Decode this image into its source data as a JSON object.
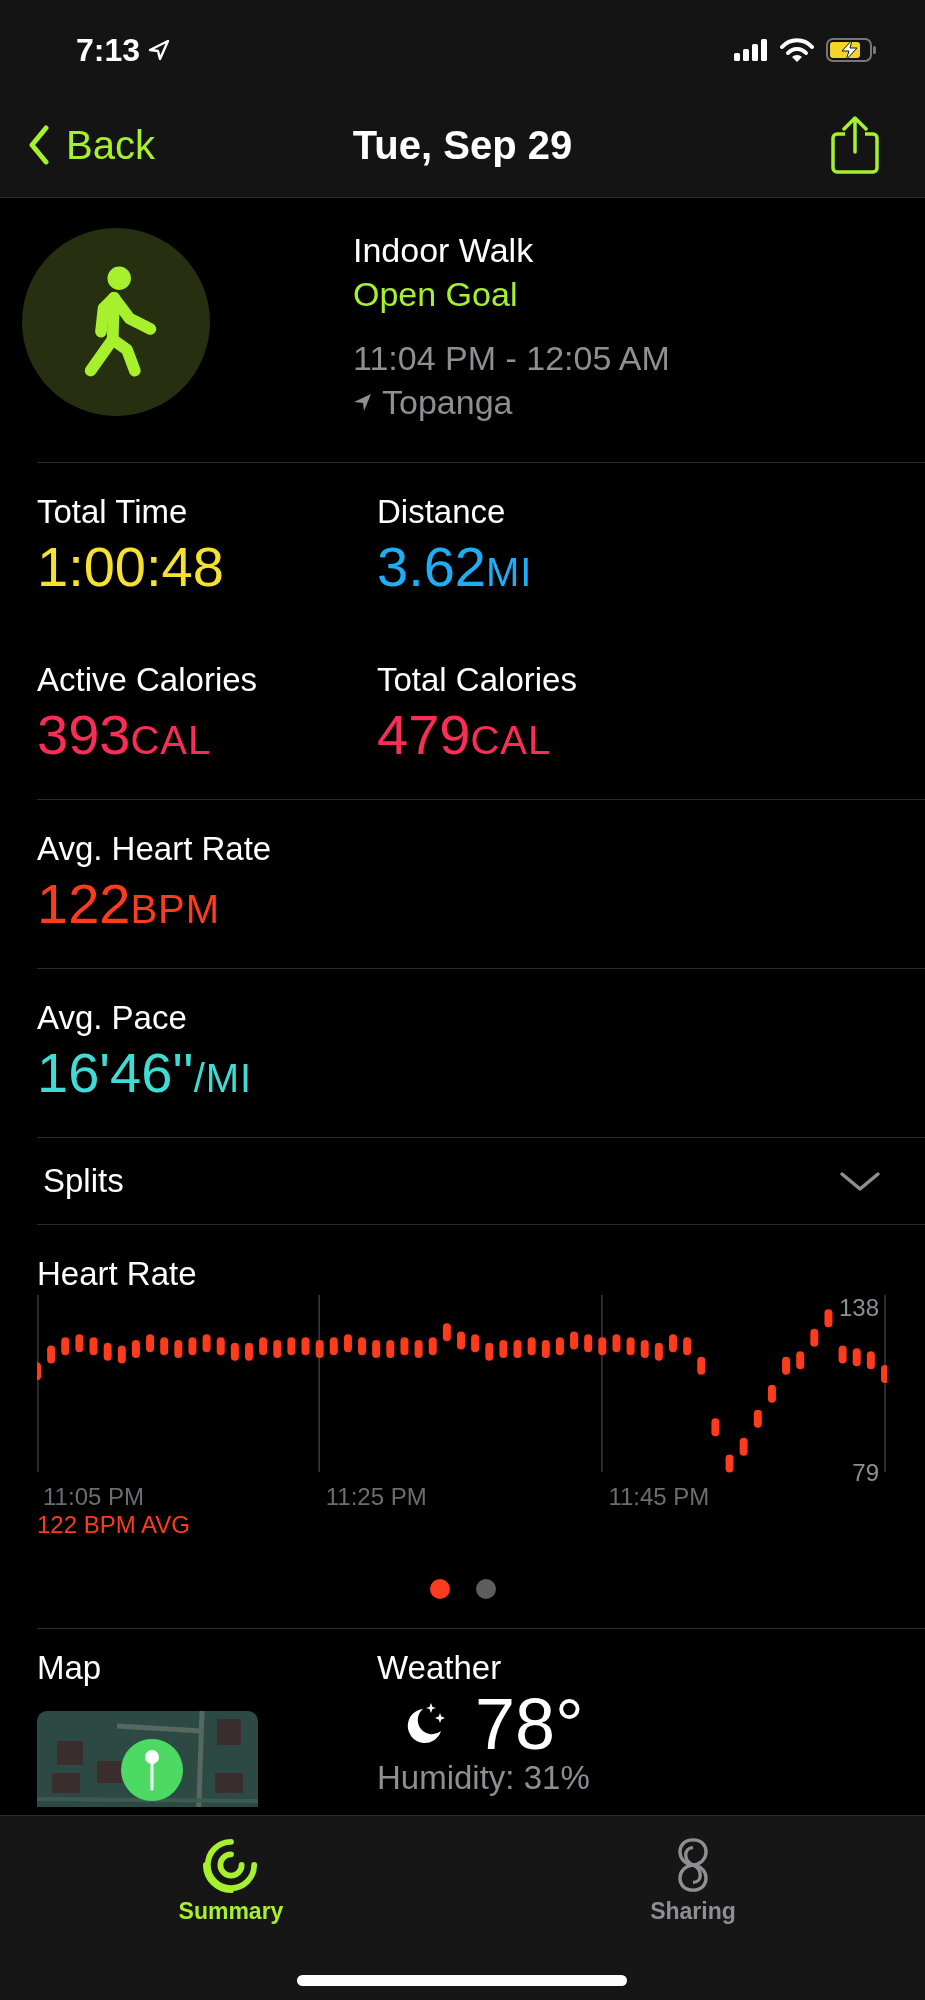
{
  "status_bar": {
    "time": "7:13"
  },
  "nav": {
    "back": "Back",
    "title": "Tue, Sep 29"
  },
  "workout": {
    "name": "Indoor Walk",
    "goal": "Open Goal",
    "time_range": "11:04 PM - 12:05 AM",
    "location": "Topanga"
  },
  "metric_rows": [
    [
      {
        "label": "Total Time",
        "value": "1:00:48",
        "color": "#f5e12e"
      },
      {
        "label": "Distance",
        "value": "3.62",
        "unit": "MI",
        "color": "#1eaef5"
      }
    ],
    [
      {
        "label": "Active Calories",
        "value": "393",
        "unit": "CAL",
        "color": "#fa2d55"
      },
      {
        "label": "Total Calories",
        "value": "479",
        "unit": "CAL",
        "color": "#fa2d55"
      }
    ],
    [
      {
        "label": "Avg. Heart Rate",
        "value": "122",
        "unit": "BPM",
        "color": "#ff3b1e"
      }
    ],
    [
      {
        "label": "Avg. Pace",
        "value": "16'46''",
        "unit": "/MI",
        "color": "#3fdcd6"
      }
    ]
  ],
  "splits": {
    "label": "Splits",
    "expanded": false
  },
  "heart_rate": {
    "title": "Heart Rate",
    "average": "122 BPM AVG",
    "chart_data": {
      "type": "scatter",
      "categories": [
        null,
        null,
        null,
        null,
        "11:05 PM",
        null,
        null,
        null,
        null,
        null,
        null,
        null,
        null,
        null,
        null,
        null,
        null,
        null,
        null,
        null,
        null,
        null,
        null,
        null,
        "11:25 PM",
        null,
        null,
        null,
        null,
        null,
        null,
        null,
        null,
        null,
        null,
        null,
        null,
        null,
        null,
        null,
        null,
        null,
        null,
        null,
        "11:45 PM",
        null,
        null,
        null,
        null,
        null,
        null,
        null,
        null,
        null,
        null,
        null,
        null,
        null,
        null,
        null,
        null
      ],
      "series": [
        {
          "color": "#ff3b1e",
          "values": [
            115,
            121,
            124,
            125,
            124,
            122,
            121,
            123,
            125,
            124,
            123,
            124,
            125,
            124,
            122,
            122,
            124,
            123,
            124,
            124,
            123,
            124,
            125,
            124,
            123,
            123,
            124,
            123,
            124,
            129,
            126,
            125,
            122,
            123,
            123,
            124,
            123,
            124,
            126,
            125,
            124,
            125,
            124,
            123,
            122,
            125,
            124,
            117,
            95,
            82,
            88,
            98,
            107,
            117,
            119,
            127,
            134,
            121,
            120,
            119,
            114
          ]
        }
      ],
      "ylim": [
        79,
        138
      ],
      "yticks": [
        79,
        138
      ]
    }
  },
  "pager": [
    {
      "selected": true
    },
    {
      "selected": false
    }
  ],
  "map": {
    "title": "Map",
    "kind": "picture"
  },
  "weather": {
    "title": "Weather",
    "temperature": "78°",
    "humidity": "Humidity: 31%"
  },
  "tabs": [
    {
      "label": "Summary",
      "selected": true
    },
    {
      "label": "Sharing",
      "selected": false
    }
  ]
}
